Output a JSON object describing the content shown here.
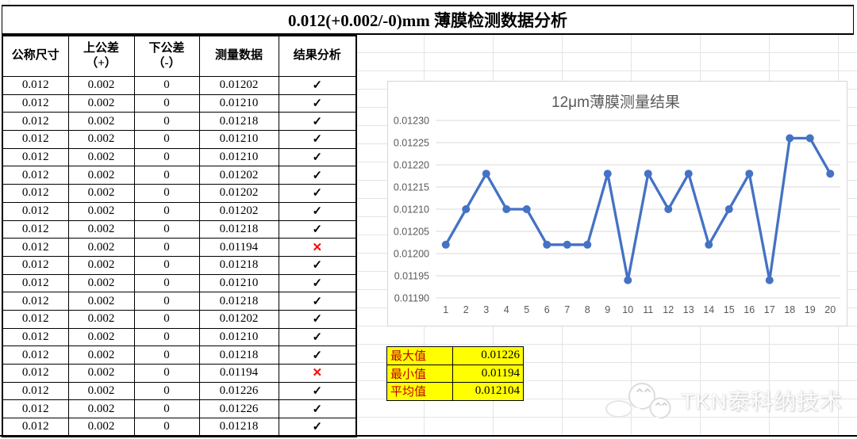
{
  "title": "0.012(+0.002/-0)mm 薄膜检测数据分析",
  "table": {
    "headers": [
      {
        "lines": [
          "公称尺寸"
        ]
      },
      {
        "lines": [
          "上公差",
          "（+）"
        ]
      },
      {
        "lines": [
          "下公差",
          "（-）"
        ]
      },
      {
        "lines": [
          "测量数据"
        ]
      },
      {
        "lines": [
          "结果分析"
        ]
      }
    ],
    "rows": [
      {
        "nominal": "0.012",
        "upper": "0.002",
        "lower": "0",
        "measured": "0.01202",
        "result": "pass"
      },
      {
        "nominal": "0.012",
        "upper": "0.002",
        "lower": "0",
        "measured": "0.01210",
        "result": "pass"
      },
      {
        "nominal": "0.012",
        "upper": "0.002",
        "lower": "0",
        "measured": "0.01218",
        "result": "pass"
      },
      {
        "nominal": "0.012",
        "upper": "0.002",
        "lower": "0",
        "measured": "0.01210",
        "result": "pass"
      },
      {
        "nominal": "0.012",
        "upper": "0.002",
        "lower": "0",
        "measured": "0.01210",
        "result": "pass"
      },
      {
        "nominal": "0.012",
        "upper": "0.002",
        "lower": "0",
        "measured": "0.01202",
        "result": "pass"
      },
      {
        "nominal": "0.012",
        "upper": "0.002",
        "lower": "0",
        "measured": "0.01202",
        "result": "pass"
      },
      {
        "nominal": "0.012",
        "upper": "0.002",
        "lower": "0",
        "measured": "0.01202",
        "result": "pass"
      },
      {
        "nominal": "0.012",
        "upper": "0.002",
        "lower": "0",
        "measured": "0.01218",
        "result": "pass"
      },
      {
        "nominal": "0.012",
        "upper": "0.002",
        "lower": "0",
        "measured": "0.01194",
        "result": "fail"
      },
      {
        "nominal": "0.012",
        "upper": "0.002",
        "lower": "0",
        "measured": "0.01218",
        "result": "pass"
      },
      {
        "nominal": "0.012",
        "upper": "0.002",
        "lower": "0",
        "measured": "0.01210",
        "result": "pass"
      },
      {
        "nominal": "0.012",
        "upper": "0.002",
        "lower": "0",
        "measured": "0.01218",
        "result": "pass"
      },
      {
        "nominal": "0.012",
        "upper": "0.002",
        "lower": "0",
        "measured": "0.01202",
        "result": "pass"
      },
      {
        "nominal": "0.012",
        "upper": "0.002",
        "lower": "0",
        "measured": "0.01210",
        "result": "pass"
      },
      {
        "nominal": "0.012",
        "upper": "0.002",
        "lower": "0",
        "measured": "0.01218",
        "result": "pass"
      },
      {
        "nominal": "0.012",
        "upper": "0.002",
        "lower": "0",
        "measured": "0.01194",
        "result": "fail"
      },
      {
        "nominal": "0.012",
        "upper": "0.002",
        "lower": "0",
        "measured": "0.01226",
        "result": "pass"
      },
      {
        "nominal": "0.012",
        "upper": "0.002",
        "lower": "0",
        "measured": "0.01226",
        "result": "pass"
      },
      {
        "nominal": "0.012",
        "upper": "0.002",
        "lower": "0",
        "measured": "0.01218",
        "result": "pass"
      }
    ],
    "result_glyphs": {
      "pass": "✓",
      "fail": "✕"
    }
  },
  "summary": {
    "rows": [
      {
        "label": "最大值",
        "value": "0.01226"
      },
      {
        "label": "最小值",
        "value": "0.01194"
      },
      {
        "label": "平均值",
        "value": "0.012104"
      }
    ]
  },
  "chart_data": {
    "type": "line",
    "title": "12μm薄膜测量结果",
    "x": [
      1,
      2,
      3,
      4,
      5,
      6,
      7,
      8,
      9,
      10,
      11,
      12,
      13,
      14,
      15,
      16,
      17,
      18,
      19,
      20
    ],
    "values": [
      0.01202,
      0.0121,
      0.01218,
      0.0121,
      0.0121,
      0.01202,
      0.01202,
      0.01202,
      0.01218,
      0.01194,
      0.01218,
      0.0121,
      0.01218,
      0.01202,
      0.0121,
      0.01218,
      0.01194,
      0.01226,
      0.01226,
      0.01218
    ],
    "xlabel": "",
    "ylabel": "",
    "ylim": [
      0.0119,
      0.0123
    ],
    "ytick_step": 5e-05,
    "ytick_decimals": 5,
    "grid": true,
    "legend": false,
    "line_color": "#4472C4",
    "marker": "circle",
    "gridline_color": "#d9d9d9",
    "label_color": "#595959",
    "title_color": "#595959"
  },
  "watermark": {
    "text": "TKN泰科纳技术",
    "icon": "wechat-icon"
  },
  "colors": {
    "summary_bg": "#FFFF00",
    "summary_label": "#C00000",
    "fail_mark": "#FF0000",
    "pass_mark": "#000000"
  }
}
